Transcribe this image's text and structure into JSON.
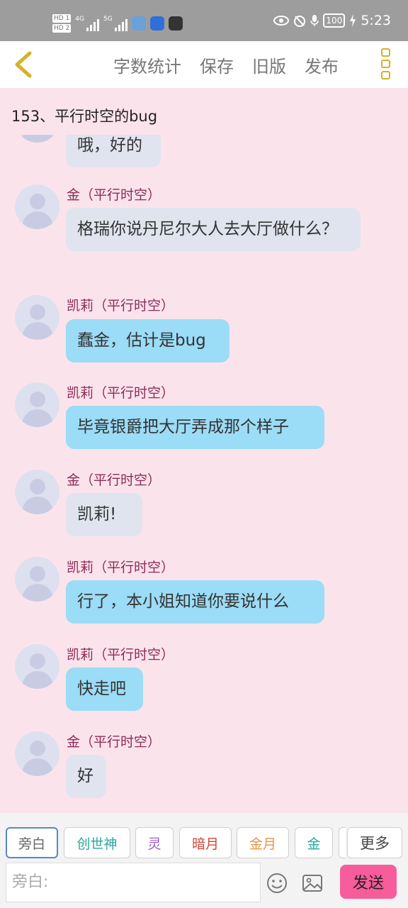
{
  "status_bar": {
    "hd1": "HD 1",
    "hd2": "HD 2",
    "signal1_label": "4G",
    "signal2_label": "5G",
    "battery": "100",
    "time": "5:23"
  },
  "toolbar": {
    "word_count": "字数统计",
    "save": "保存",
    "old_version": "旧版",
    "publish": "发布"
  },
  "chapter_title": "153、平行时空的bug",
  "messages": [
    {
      "sender": "",
      "text": "哦，好的",
      "style": "gray"
    },
    {
      "sender": "金（平行时空）",
      "text": "格瑞你说丹尼尔大人去大厅做什么？",
      "style": "gray"
    },
    {
      "sender": "凯莉（平行时空）",
      "text": "蠢金，估计是bug",
      "style": "blue"
    },
    {
      "sender": "凯莉（平行时空）",
      "text": "毕竟银爵把大厅弄成那个样子",
      "style": "blue"
    },
    {
      "sender": "金（平行时空）",
      "text": "凯莉!",
      "style": "gray"
    },
    {
      "sender": "凯莉（平行时空）",
      "text": "行了，本小姐知道你要说什么",
      "style": "blue"
    },
    {
      "sender": "凯莉（平行时空）",
      "text": "快走吧",
      "style": "blue"
    },
    {
      "sender": "金（平行时空）",
      "text": "好",
      "style": "gray"
    }
  ],
  "characters": [
    {
      "label": "旁白",
      "color": "#666666"
    },
    {
      "label": "创世神",
      "color": "#2aa89a"
    },
    {
      "label": "灵",
      "color": "#9a5fc6"
    },
    {
      "label": "暗月",
      "color": "#d0473a"
    },
    {
      "label": "金月",
      "color": "#e8954a"
    },
    {
      "label": "金",
      "color": "#2aa89a"
    }
  ],
  "more_label": "更多",
  "input": {
    "placeholder": "旁白:"
  },
  "send_label": "发送",
  "colors": {
    "accent": "#f75c9b",
    "sender": "#8c2b58",
    "background": "#fbe3ec"
  }
}
